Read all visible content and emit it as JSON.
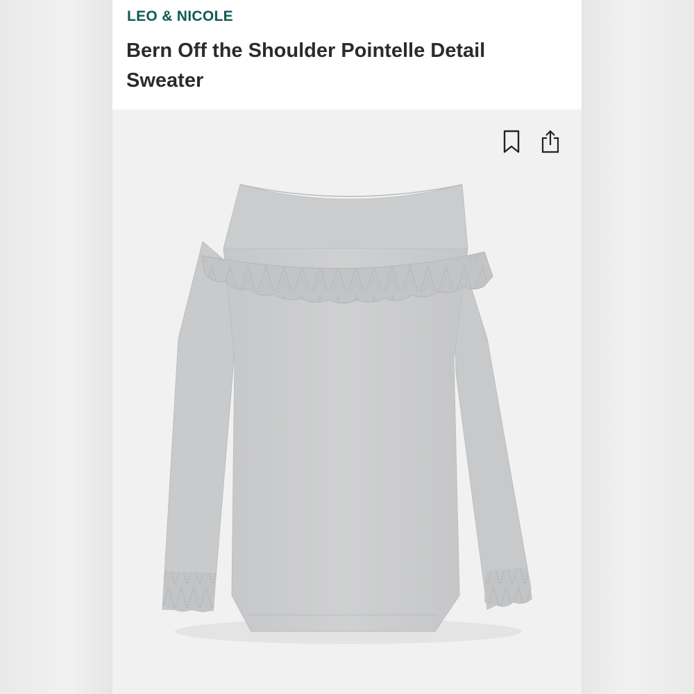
{
  "product": {
    "brand": "LEO & NICOLE",
    "title": "Bern Off the Shoulder Pointelle Detail Sweater"
  },
  "actions": {
    "bookmark_icon": "bookmark-icon",
    "share_icon": "share-icon"
  },
  "colors": {
    "brand": "#0f5b52",
    "title": "#2b2b2b",
    "sweater": "#c9cacb",
    "image_background": "#f1f1f2"
  }
}
